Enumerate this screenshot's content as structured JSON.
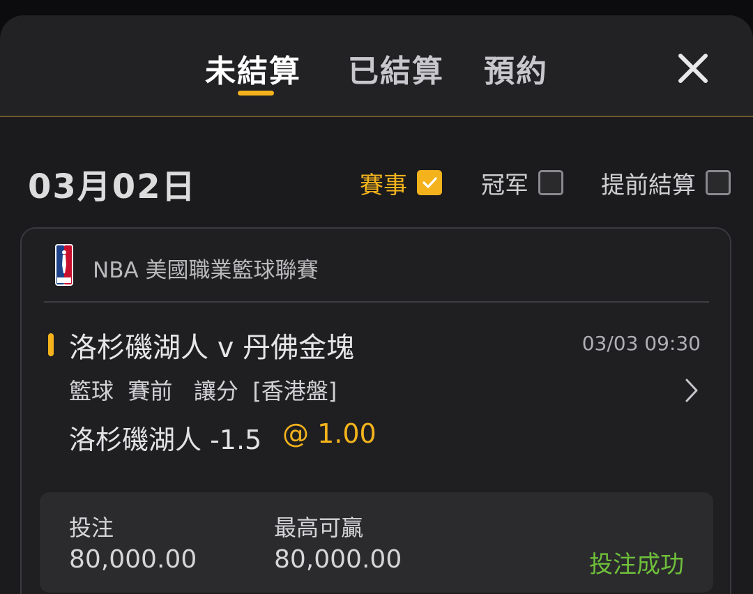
{
  "tabs": [
    {
      "label": "未結算",
      "active": true
    },
    {
      "label": "已結算",
      "active": false
    },
    {
      "label": "預約",
      "active": false
    }
  ],
  "close_icon": "close-icon",
  "date": "03月02日",
  "filters": [
    {
      "label": "賽事",
      "checked": true
    },
    {
      "label": "冠军",
      "checked": false
    },
    {
      "label": "提前結算",
      "checked": false
    }
  ],
  "card": {
    "league_logo": "nba-logo-icon",
    "league": "NBA 美國職業籃球聯賽",
    "match_title": "洛杉磯湖人 v 丹佛金塊",
    "match_time": "03/03 09:30",
    "bet_info": "籃球  賽前   讓分  [香港盤]",
    "selection": "洛杉磯湖人 -1.5",
    "odds": "@ 1.00",
    "stake_label": "投注",
    "stake_value": "80,000.00",
    "max_win_label": "最高可贏",
    "max_win_value": "80,000.00",
    "status": "投注成功"
  },
  "colors": {
    "accent": "#f4b31c",
    "success": "#6fbf3a",
    "background": "#1b1b1e"
  }
}
